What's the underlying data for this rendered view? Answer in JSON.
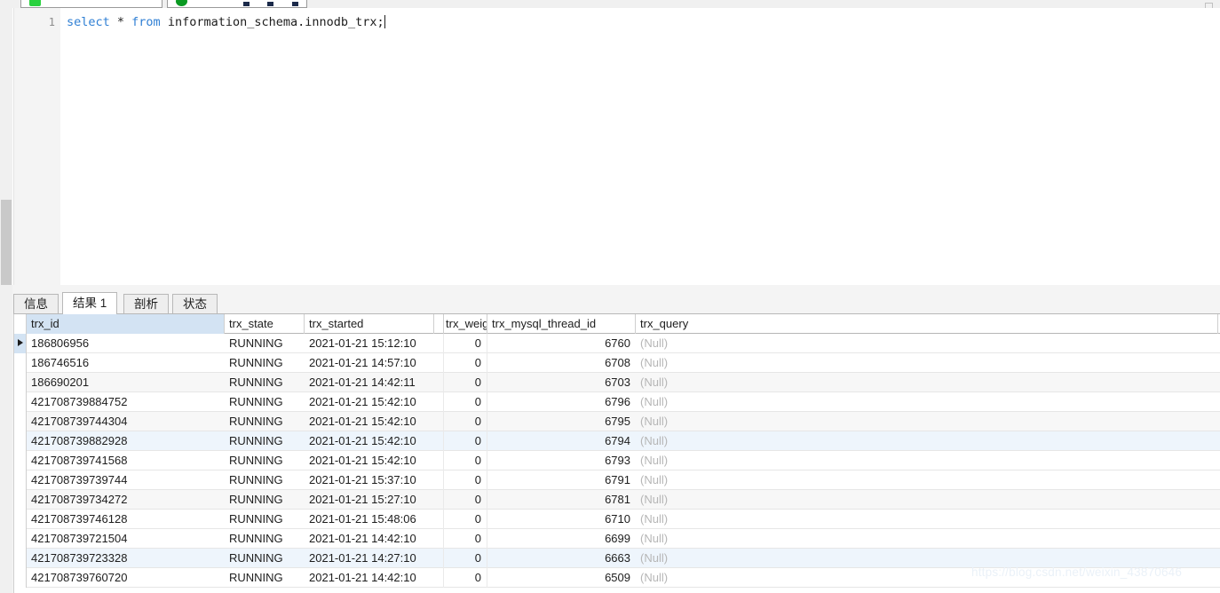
{
  "toolbar": {
    "run_button_label": "",
    "stop_button_label": "",
    "run_icon": "run-green-icon",
    "stop_icon": "stop-green-circle-icon"
  },
  "editor": {
    "line_number": "1",
    "sql_keyword_1": "select",
    "sql_operator": " * ",
    "sql_keyword_2": "from",
    "sql_object": " information_schema.innodb_trx;"
  },
  "tabs": [
    {
      "label": "信息",
      "active": false
    },
    {
      "label": "结果 1",
      "active": true
    },
    {
      "label": "剖析",
      "active": false
    },
    {
      "label": "状态",
      "active": false
    }
  ],
  "grid": {
    "columns": [
      {
        "key": "trx_id",
        "label": "trx_id",
        "align": "left",
        "selected": true
      },
      {
        "key": "trx_state",
        "label": "trx_state",
        "align": "left",
        "selected": false
      },
      {
        "key": "trx_started",
        "label": "trx_started",
        "align": "left",
        "selected": false
      },
      {
        "key": "trx_narrow",
        "label": "",
        "align": "left",
        "selected": false
      },
      {
        "key": "trx_weight",
        "label": "trx_weig",
        "align": "left",
        "selected": false
      },
      {
        "key": "trx_mysql_thread_id",
        "label": "trx_mysql_thread_id",
        "align": "left",
        "selected": false
      },
      {
        "key": "trx_query",
        "label": "trx_query",
        "align": "left",
        "selected": false
      }
    ],
    "null_text": "(Null)",
    "rows": [
      {
        "trx_id": "186806956",
        "trx_state": "RUNNING",
        "trx_started": "2021-01-21 15:12:10",
        "trx_weight": "0",
        "trx_mysql_thread_id": "6760",
        "trx_query": "(Null)",
        "current": true,
        "stripe": "none"
      },
      {
        "trx_id": "186746516",
        "trx_state": "RUNNING",
        "trx_started": "2021-01-21 14:57:10",
        "trx_weight": "0",
        "trx_mysql_thread_id": "6708",
        "trx_query": "(Null)",
        "current": false,
        "stripe": "none"
      },
      {
        "trx_id": "186690201",
        "trx_state": "RUNNING",
        "trx_started": "2021-01-21 14:42:11",
        "trx_weight": "0",
        "trx_mysql_thread_id": "6703",
        "trx_query": "(Null)",
        "current": false,
        "stripe": "alt"
      },
      {
        "trx_id": "421708739884752",
        "trx_state": "RUNNING",
        "trx_started": "2021-01-21 15:42:10",
        "trx_weight": "0",
        "trx_mysql_thread_id": "6796",
        "trx_query": "(Null)",
        "current": false,
        "stripe": "none"
      },
      {
        "trx_id": "421708739744304",
        "trx_state": "RUNNING",
        "trx_started": "2021-01-21 15:42:10",
        "trx_weight": "0",
        "trx_mysql_thread_id": "6795",
        "trx_query": "(Null)",
        "current": false,
        "stripe": "alt"
      },
      {
        "trx_id": "421708739882928",
        "trx_state": "RUNNING",
        "trx_started": "2021-01-21 15:42:10",
        "trx_weight": "0",
        "trx_mysql_thread_id": "6794",
        "trx_query": "(Null)",
        "current": false,
        "stripe": "sel"
      },
      {
        "trx_id": "421708739741568",
        "trx_state": "RUNNING",
        "trx_started": "2021-01-21 15:42:10",
        "trx_weight": "0",
        "trx_mysql_thread_id": "6793",
        "trx_query": "(Null)",
        "current": false,
        "stripe": "none"
      },
      {
        "trx_id": "421708739739744",
        "trx_state": "RUNNING",
        "trx_started": "2021-01-21 15:37:10",
        "trx_weight": "0",
        "trx_mysql_thread_id": "6791",
        "trx_query": "(Null)",
        "current": false,
        "stripe": "none"
      },
      {
        "trx_id": "421708739734272",
        "trx_state": "RUNNING",
        "trx_started": "2021-01-21 15:27:10",
        "trx_weight": "0",
        "trx_mysql_thread_id": "6781",
        "trx_query": "(Null)",
        "current": false,
        "stripe": "alt"
      },
      {
        "trx_id": "421708739746128",
        "trx_state": "RUNNING",
        "trx_started": "2021-01-21 15:48:06",
        "trx_weight": "0",
        "trx_mysql_thread_id": "6710",
        "trx_query": "(Null)",
        "current": false,
        "stripe": "none"
      },
      {
        "trx_id": "421708739721504",
        "trx_state": "RUNNING",
        "trx_started": "2021-01-21 14:42:10",
        "trx_weight": "0",
        "trx_mysql_thread_id": "6699",
        "trx_query": "(Null)",
        "current": false,
        "stripe": "none"
      },
      {
        "trx_id": "421708739723328",
        "trx_state": "RUNNING",
        "trx_started": "2021-01-21 14:27:10",
        "trx_weight": "0",
        "trx_mysql_thread_id": "6663",
        "trx_query": "(Null)",
        "current": false,
        "stripe": "sel"
      },
      {
        "trx_id": "421708739760720",
        "trx_state": "RUNNING",
        "trx_started": "2021-01-21 14:42:10",
        "trx_weight": "0",
        "trx_mysql_thread_id": "6509",
        "trx_query": "(Null)",
        "current": false,
        "stripe": "none"
      }
    ]
  },
  "watermark": {
    "text": "https://blog.csdn.net/weixin_43870646"
  }
}
